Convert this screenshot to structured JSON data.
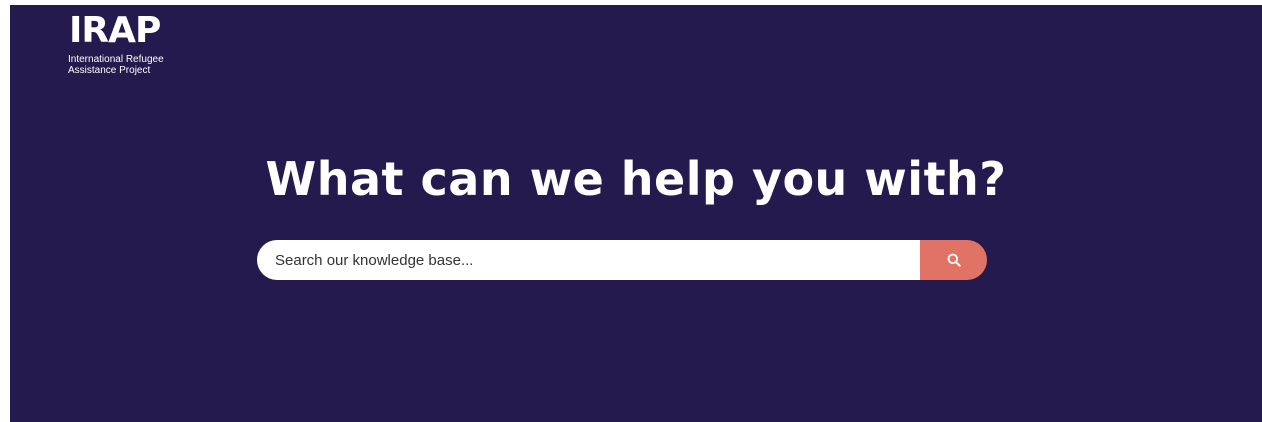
{
  "logo": {
    "mark": "IRAP",
    "subtitle": "International Refugee Assistance Project"
  },
  "hero": {
    "headline": "What can we help you with?"
  },
  "search": {
    "placeholder": "Search our knowledge base...",
    "icon": "search-icon"
  },
  "colors": {
    "hero_background": "#241A4D",
    "search_button": "#E07365",
    "text_light": "#ffffff"
  }
}
